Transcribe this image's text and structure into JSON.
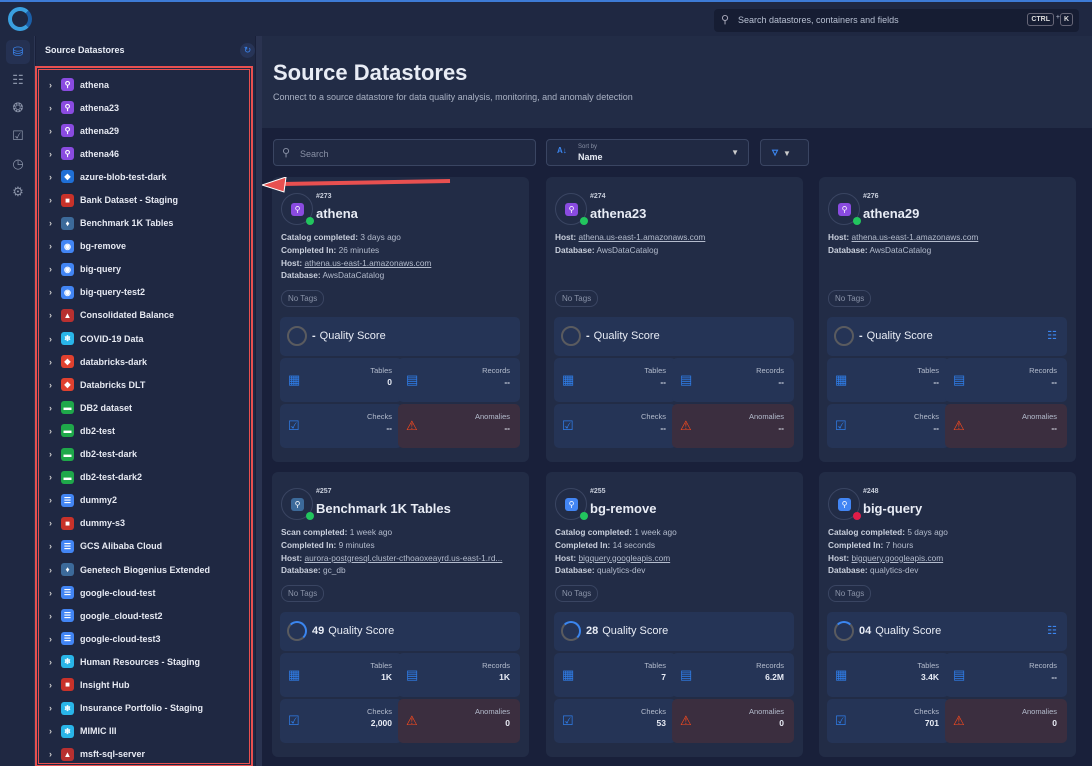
{
  "topbar": {
    "search_placeholder": "Search datastores, containers and fields",
    "kbd_ctrl": "CTRL",
    "kbd_plus": "+",
    "kbd_k": "K"
  },
  "sidebar": {
    "title": "Source Datastores",
    "items": [
      {
        "label": "athena",
        "icon": "athena",
        "color": "#8a4be0"
      },
      {
        "label": "athena23",
        "icon": "athena",
        "color": "#8a4be0"
      },
      {
        "label": "athena29",
        "icon": "athena",
        "color": "#8a4be0"
      },
      {
        "label": "athena46",
        "icon": "athena",
        "color": "#8a4be0"
      },
      {
        "label": "azure-blob-test-dark",
        "icon": "azure",
        "color": "#1f6fd6"
      },
      {
        "label": "Bank Dataset - Staging",
        "icon": "s3",
        "color": "#c8322a"
      },
      {
        "label": "Benchmark 1K Tables",
        "icon": "postgresql",
        "color": "#3c6a9a"
      },
      {
        "label": "bg-remove",
        "icon": "bigquery",
        "color": "#4285f4"
      },
      {
        "label": "big-query",
        "icon": "bigquery",
        "color": "#4285f4"
      },
      {
        "label": "big-query-test2",
        "icon": "bigquery",
        "color": "#4285f4"
      },
      {
        "label": "Consolidated Balance",
        "icon": "sqlserver",
        "color": "#b83030"
      },
      {
        "label": "COVID-19 Data",
        "icon": "snowflake",
        "color": "#29b5e8"
      },
      {
        "label": "databricks-dark",
        "icon": "databricks",
        "color": "#e0412f"
      },
      {
        "label": "Databricks DLT",
        "icon": "databricks",
        "color": "#e0412f"
      },
      {
        "label": "DB2 dataset",
        "icon": "db2",
        "color": "#1fa84a"
      },
      {
        "label": "db2-test",
        "icon": "db2",
        "color": "#1fa84a"
      },
      {
        "label": "db2-test-dark",
        "icon": "db2",
        "color": "#1fa84a"
      },
      {
        "label": "db2-test-dark2",
        "icon": "db2",
        "color": "#1fa84a"
      },
      {
        "label": "dummy2",
        "icon": "gcs",
        "color": "#4285f4"
      },
      {
        "label": "dummy-s3",
        "icon": "s3",
        "color": "#c8322a"
      },
      {
        "label": "GCS Alibaba Cloud",
        "icon": "gcs",
        "color": "#4285f4"
      },
      {
        "label": "Genetech Biogenius Extended",
        "icon": "postgresql",
        "color": "#3c6a9a"
      },
      {
        "label": "google-cloud-test",
        "icon": "gcs",
        "color": "#4285f4"
      },
      {
        "label": "google_cloud-test2",
        "icon": "gcs",
        "color": "#4285f4"
      },
      {
        "label": "google-cloud-test3",
        "icon": "gcs",
        "color": "#4285f4"
      },
      {
        "label": "Human Resources - Staging",
        "icon": "snowflake",
        "color": "#29b5e8"
      },
      {
        "label": "Insight Hub",
        "icon": "s3",
        "color": "#c8322a"
      },
      {
        "label": "Insurance Portfolio - Staging",
        "icon": "snowflake",
        "color": "#29b5e8"
      },
      {
        "label": "MIMIC III",
        "icon": "snowflake",
        "color": "#29b5e8"
      },
      {
        "label": "msft-sql-server",
        "icon": "sqlserver",
        "color": "#b83030"
      }
    ]
  },
  "main": {
    "title": "Source Datastores",
    "subtitle": "Connect to a source datastore for data quality analysis, monitoring, and anomaly detection",
    "search_placeholder": "Search",
    "sort_label": "Sort by",
    "sort_value": "Name",
    "labels": {
      "quality": "Quality Score",
      "tables": "Tables",
      "records": "Records",
      "checks": "Checks",
      "anomalies": "Anomalies",
      "no_tags": "No Tags"
    },
    "cards": [
      {
        "id": "#273",
        "name": "athena",
        "icon_color": "#8a4be0",
        "status": "#22c55e",
        "meta": [
          [
            "Catalog completed:",
            "3 days ago",
            false
          ],
          [
            "Completed In:",
            "26 minutes",
            false
          ],
          [
            "Host:",
            "athena.us-east-1.amazonaws.com",
            true
          ],
          [
            "Database:",
            "AwsDataCatalog",
            false
          ]
        ],
        "score": "-",
        "score_pct": 0,
        "hierarchy": false,
        "tables": "0",
        "records": "--",
        "checks": "--",
        "anomalies": "--"
      },
      {
        "id": "#274",
        "name": "athena23",
        "icon_color": "#8a4be0",
        "status": "#22c55e",
        "meta": [
          [
            "Host:",
            "athena.us-east-1.amazonaws.com",
            true
          ],
          [
            "Database:",
            "AwsDataCatalog",
            false
          ]
        ],
        "score": "-",
        "score_pct": 0,
        "hierarchy": false,
        "tables": "--",
        "records": "--",
        "checks": "--",
        "anomalies": "--"
      },
      {
        "id": "#276",
        "name": "athena29",
        "icon_color": "#8a4be0",
        "status": "#22c55e",
        "meta": [
          [
            "Host:",
            "athena.us-east-1.amazonaws.com",
            true
          ],
          [
            "Database:",
            "AwsDataCatalog",
            false
          ]
        ],
        "score": "-",
        "score_pct": 0,
        "hierarchy": true,
        "tables": "--",
        "records": "--",
        "checks": "--",
        "anomalies": "--"
      },
      {
        "id": "#257",
        "name": "Benchmark 1K Tables",
        "icon_color": "#3c6a9a",
        "status": "#22c55e",
        "meta": [
          [
            "Scan completed:",
            "1 week ago",
            false
          ],
          [
            "Completed In:",
            "9 minutes",
            false
          ],
          [
            "Host:",
            "aurora-postgresql.cluster-cthoaoxeayrd.us-east-1.rd...",
            true
          ],
          [
            "Database:",
            "gc_db",
            false
          ]
        ],
        "score": "49",
        "score_pct": 49,
        "hierarchy": false,
        "tables": "1K",
        "records": "1K",
        "checks": "2,000",
        "anomalies": "0"
      },
      {
        "id": "#255",
        "name": "bg-remove",
        "icon_color": "#4285f4",
        "status": "#22c55e",
        "meta": [
          [
            "Catalog completed:",
            "1 week ago",
            false
          ],
          [
            "Completed In:",
            "14 seconds",
            false
          ],
          [
            "Host:",
            "bigquery.googleapis.com",
            true
          ],
          [
            "Database:",
            "qualytics-dev",
            false
          ]
        ],
        "score": "28",
        "score_pct": 28,
        "hierarchy": false,
        "tables": "7",
        "records": "6.2M",
        "checks": "53",
        "anomalies": "0"
      },
      {
        "id": "#248",
        "name": "big-query",
        "icon_color": "#4285f4",
        "status": "#e11d48",
        "meta": [
          [
            "Catalog completed:",
            "5 days ago",
            false
          ],
          [
            "Completed In:",
            "7 hours",
            false
          ],
          [
            "Host:",
            "bigquery.googleapis.com",
            true
          ],
          [
            "Database:",
            "qualytics-dev",
            false
          ]
        ],
        "score": "04",
        "score_pct": 4,
        "hierarchy": true,
        "tables": "3.4K",
        "records": "--",
        "checks": "701",
        "anomalies": "0"
      }
    ]
  }
}
